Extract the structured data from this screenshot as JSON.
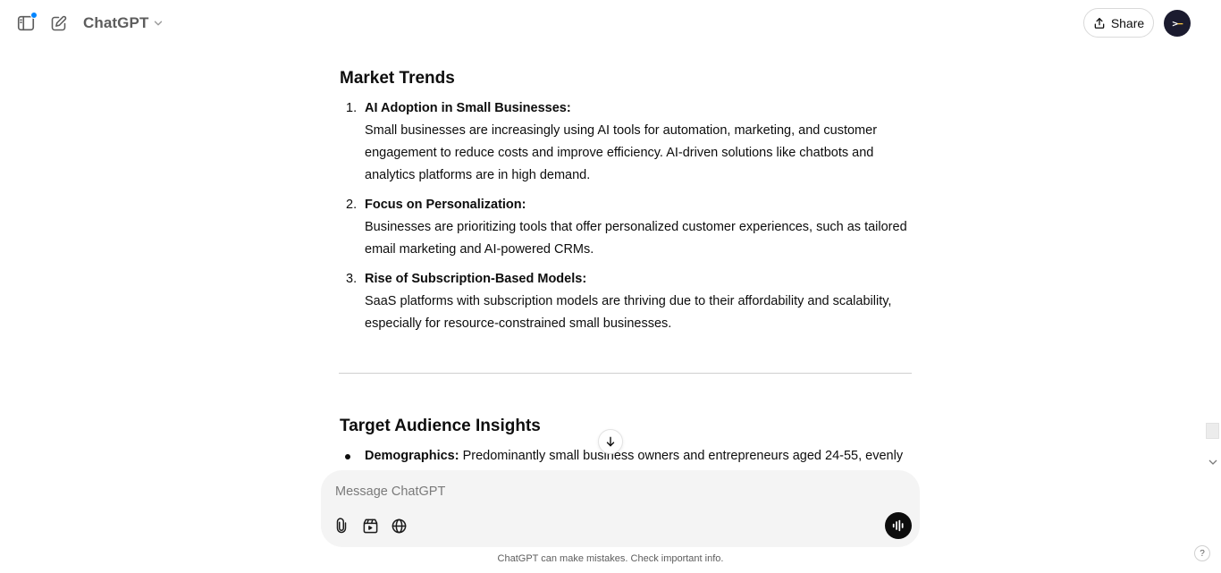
{
  "header": {
    "model_name": "ChatGPT",
    "share_label": "Share",
    "avatar_text": ">",
    "avatar_text_accent": "−"
  },
  "content": {
    "market_heading": "Market Trends",
    "trends": [
      {
        "number": "1.",
        "title": "AI Adoption in Small Businesses:",
        "lines": [
          "Small businesses are increasingly using AI tools for automation, marketing, and customer",
          "engagement to reduce costs and improve efficiency. AI-driven solutions like chatbots and",
          "analytics platforms are in high demand."
        ]
      },
      {
        "number": "2.",
        "title": "Focus on Personalization:",
        "lines": [
          "Businesses are prioritizing tools that offer personalized customer experiences, such as tailored",
          "email marketing and AI-powered CRMs."
        ]
      },
      {
        "number": "3.",
        "title": "Rise of Subscription-Based Models:",
        "lines": [
          "SaaS platforms with subscription models are thriving due to their affordability and scalability,",
          "especially for resource-constrained small businesses."
        ]
      }
    ],
    "audience_heading": "Target Audience Insights",
    "audience_bullet": {
      "label": "Demographics:",
      "text": " Predominantly small business owners and entrepreneurs aged 24-55, evenly"
    }
  },
  "composer": {
    "placeholder": "Message ChatGPT"
  },
  "footer": {
    "disclaimer": "ChatGPT can make mistakes. Check important info.",
    "help_label": "?"
  },
  "colors": {
    "text": "#0d0d0d",
    "muted": "#5d5d5d",
    "composer_bg": "#f4f4f4",
    "notification_dot": "#0285ff"
  }
}
